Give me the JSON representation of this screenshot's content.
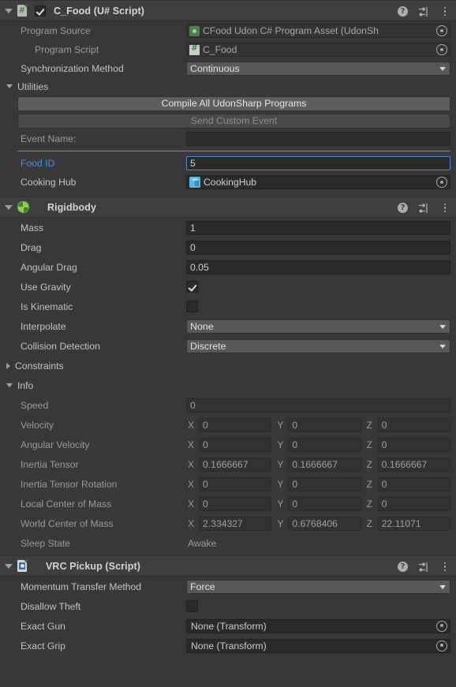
{
  "theme": {
    "bg": "#383838",
    "header_bg": "#3e3e3e",
    "input_bg": "#2a2a2a",
    "dropdown_bg": "#585858",
    "accent_blue": "#4d8fe0",
    "rigidbody_green": "#8fd14f"
  },
  "components": [
    {
      "id": "udonsharp",
      "title": "C_Food (U# Script)",
      "icon": "csharp-script-icon",
      "enabled": true,
      "expanded": true,
      "header_icons": [
        "help-icon",
        "preset-icon",
        "menu-icon"
      ],
      "fields": {
        "program_source_label": "Program Source",
        "program_source_value": "CFood Udon C# Program Asset (UdonSh",
        "program_script_label": "Program Script",
        "program_script_value": "C_Food",
        "sync_label": "Synchronization Method",
        "sync_value": "Continuous",
        "utilities_label": "Utilities",
        "compile_button": "Compile All UdonSharp Programs",
        "send_event_button": "Send Custom Event",
        "event_name_label": "Event Name:",
        "event_name_value": "",
        "food_id_label": "Food ID",
        "food_id_value": "5",
        "cooking_hub_label": "Cooking Hub",
        "cooking_hub_value": "CookingHub"
      }
    },
    {
      "id": "rigidbody",
      "title": "Rigidbody",
      "icon": "rigidbody-icon",
      "expanded": true,
      "header_icons": [
        "help-icon",
        "preset-icon",
        "menu-icon"
      ],
      "fields": {
        "mass_label": "Mass",
        "mass_value": "1",
        "drag_label": "Drag",
        "drag_value": "0",
        "angular_drag_label": "Angular Drag",
        "angular_drag_value": "0.05",
        "use_gravity_label": "Use Gravity",
        "use_gravity_value": true,
        "is_kinematic_label": "Is Kinematic",
        "is_kinematic_value": false,
        "interpolate_label": "Interpolate",
        "interpolate_value": "None",
        "collision_label": "Collision Detection",
        "collision_value": "Discrete",
        "constraints_label": "Constraints",
        "info_label": "Info"
      },
      "info": {
        "speed_label": "Speed",
        "speed_value": "0",
        "rows": [
          {
            "label": "Velocity",
            "x": "0",
            "y": "0",
            "z": "0"
          },
          {
            "label": "Angular Velocity",
            "x": "0",
            "y": "0",
            "z": "0"
          },
          {
            "label": "Inertia Tensor",
            "x": "0.1666667",
            "y": "0.1666667",
            "z": "0.1666667"
          },
          {
            "label": "Inertia Tensor Rotation",
            "x": "0",
            "y": "0",
            "z": "0"
          },
          {
            "label": "Local Center of Mass",
            "x": "0",
            "y": "0",
            "z": "0"
          },
          {
            "label": "World Center of Mass",
            "x": "2.334327",
            "y": "0.6768406",
            "z": "22.11071"
          }
        ],
        "axis_labels": {
          "x": "X",
          "y": "Y",
          "z": "Z"
        },
        "sleep_state_label": "Sleep State",
        "sleep_state_value": "Awake"
      }
    },
    {
      "id": "vrcpickup",
      "title": "VRC Pickup (Script)",
      "icon": "vrc-script-icon",
      "expanded": true,
      "header_icons": [
        "help-icon",
        "preset-icon",
        "menu-icon"
      ],
      "fields": {
        "momentum_label": "Momentum Transfer Method",
        "momentum_value": "Force",
        "disallow_theft_label": "Disallow Theft",
        "disallow_theft_value": false,
        "exact_gun_label": "Exact Gun",
        "exact_gun_value": "None (Transform)",
        "exact_grip_label": "Exact Grip",
        "exact_grip_value": "None (Transform)"
      }
    }
  ]
}
